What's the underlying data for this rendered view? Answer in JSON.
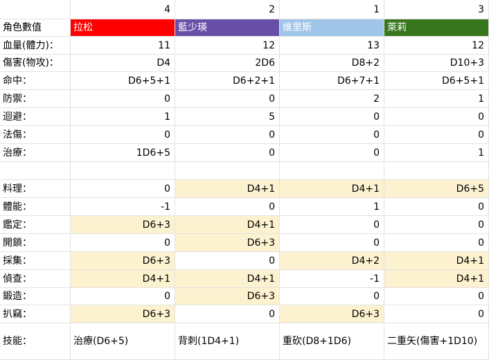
{
  "colors": {
    "highlight": "#fdf2d0",
    "grid": "#e2e2e2"
  },
  "header_numbers": [
    "4",
    "2",
    "1",
    "3"
  ],
  "labels": [
    "角色數值",
    "血量(體力)：",
    "傷害(物攻)：",
    "命中：",
    "防禦：",
    "迴避：",
    "法傷：",
    "治療：",
    "",
    "料理：",
    "體能：",
    "鑑定：",
    "開鎖：",
    "採集：",
    "偵查：",
    "鍛造：",
    "扒竊：",
    "技能："
  ],
  "characters": [
    {
      "name": "拉松",
      "color": "#ff0000",
      "values": [
        "11",
        "D4",
        "D6+5+1",
        "0",
        "1",
        "0",
        "1D6+5",
        "",
        "0",
        "-1",
        "D6+3",
        "0",
        "D6+3",
        "D4+1",
        "0",
        "D6+3"
      ],
      "highlights": [
        false,
        false,
        false,
        false,
        false,
        false,
        false,
        false,
        false,
        false,
        true,
        false,
        true,
        true,
        false,
        true
      ],
      "skill": "治療(D6+5)"
    },
    {
      "name": "藍少瑛",
      "color": "#674ea7",
      "values": [
        "12",
        "2D6",
        "D6+2+1",
        "0",
        "5",
        "0",
        "0",
        "",
        "D4+1",
        "0",
        "D4+1",
        "D6+3",
        "0",
        "D4+1",
        "D6+3",
        "0"
      ],
      "highlights": [
        false,
        false,
        false,
        false,
        false,
        false,
        false,
        false,
        true,
        false,
        true,
        true,
        false,
        true,
        true,
        false
      ],
      "skill": "背刺(1D4+1)"
    },
    {
      "name": "維里斯",
      "color": "#9fc5e8",
      "values": [
        "13",
        "D8+2",
        "D6+7+1",
        "2",
        "0",
        "0",
        "0",
        "",
        "D4+1",
        "1",
        "0",
        "0",
        "D4+2",
        "-1",
        "0",
        "D6+3"
      ],
      "highlights": [
        false,
        false,
        false,
        false,
        false,
        false,
        false,
        false,
        true,
        false,
        false,
        false,
        true,
        false,
        false,
        true
      ],
      "skill": "重砍(D8+1D6)"
    },
    {
      "name": "萊莉",
      "color": "#38761d",
      "values": [
        "12",
        "D10+3",
        "D6+5+1",
        "1",
        "0",
        "0",
        "1",
        "",
        "D6+5",
        "0",
        "0",
        "0",
        "D4+1",
        "D4+1",
        "0",
        "0"
      ],
      "highlights": [
        false,
        false,
        false,
        false,
        false,
        false,
        false,
        false,
        true,
        false,
        false,
        false,
        true,
        true,
        false,
        false
      ],
      "skill": "二重矢(傷害+1D10)"
    }
  ]
}
